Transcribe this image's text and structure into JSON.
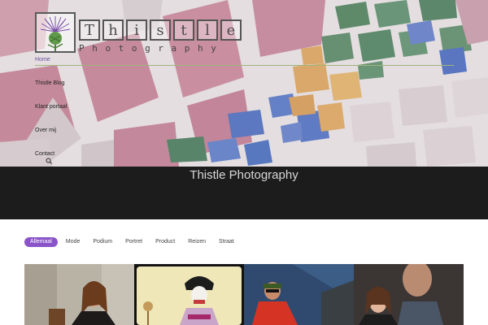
{
  "logo": {
    "letters": [
      "T",
      "h",
      "i",
      "s",
      "t",
      "l",
      "e"
    ],
    "subtitle": "Photography"
  },
  "nav": {
    "items": [
      {
        "label": "Home",
        "active": true
      },
      {
        "label": "Thistle Blog",
        "active": false
      },
      {
        "label": "Klant portaal",
        "active": false
      },
      {
        "label": "Over mij",
        "active": false
      },
      {
        "label": "Contact",
        "active": false
      }
    ],
    "search_icon": "search-icon"
  },
  "banner": {
    "title": "Thistle Photography"
  },
  "filters": [
    {
      "label": "Allemaal",
      "active": true
    },
    {
      "label": "Mode",
      "active": false
    },
    {
      "label": "Podium",
      "active": false
    },
    {
      "label": "Portret",
      "active": false
    },
    {
      "label": "Product",
      "active": false
    },
    {
      "label": "Reizen",
      "active": false
    },
    {
      "label": "Straat",
      "active": false
    }
  ],
  "colors": {
    "accent": "#8a54c8",
    "nav_active": "#6b4fa0",
    "band": "#1c1c1c"
  }
}
